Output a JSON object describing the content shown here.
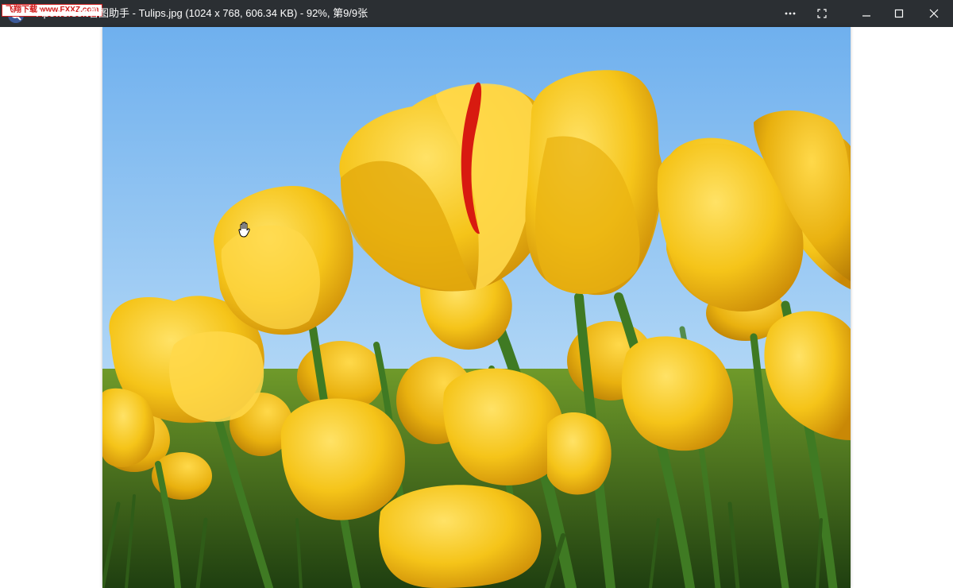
{
  "window": {
    "title": "Apowersoft看图助手 - Tulips.jpg (1024 x 768, 606.34 KB) - 92%, 第9/9张",
    "watermark": "飞翔下载 www.FXXZ.com"
  },
  "titlebar": {
    "background": "#2b2f33",
    "buttons": {
      "more_icon": "more-horizontal-icon",
      "fullscreen_icon": "fullscreen-icon",
      "minimize_icon": "minimize-icon",
      "maximize_icon": "maximize-icon",
      "close_icon": "close-icon"
    }
  },
  "viewer": {
    "image_subject": "yellow tulips against blue sky",
    "cursor_icon": "hand-grab-icon",
    "colors": {
      "sky": "#7db9ef",
      "petal": "#f2c21a",
      "petal_shadow": "#d89a08",
      "stem": "#3f7a23",
      "red_stripe": "#d81a10"
    }
  }
}
